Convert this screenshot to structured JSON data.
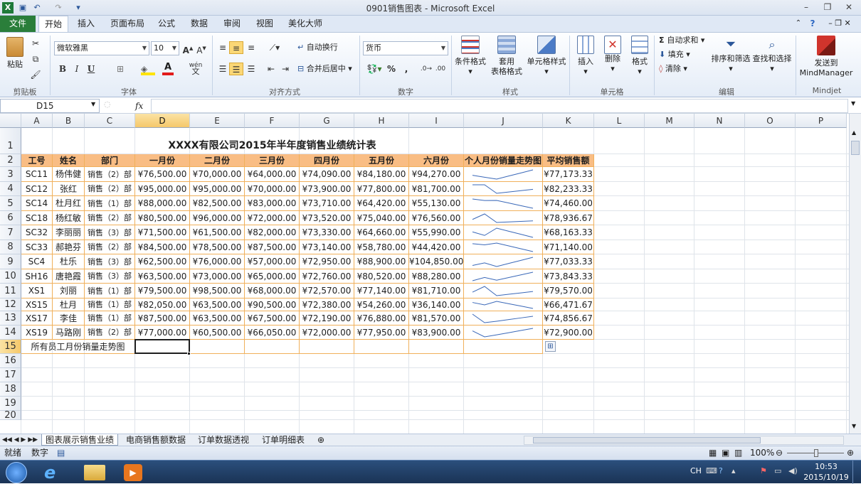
{
  "window": {
    "title": "0901销售图表 - Microsoft Excel"
  },
  "ribbon_tabs": [
    "文件",
    "开始",
    "插入",
    "页面布局",
    "公式",
    "数据",
    "审阅",
    "视图",
    "美化大师"
  ],
  "ribbon": {
    "paste_label": "粘贴",
    "clipboard_label": "剪贴板",
    "font_name": "微软雅黑",
    "font_size": "10",
    "bold": "B",
    "italic": "I",
    "underline": "U",
    "wen": "wén",
    "font_label": "字体",
    "wrap_text": "自动换行",
    "merge_center": "合并后居中",
    "align_label": "对齐方式",
    "number_format": "货币",
    "percent": "%",
    "comma": ",",
    "number_label": "数字",
    "cond_format": "条件格式",
    "table_format_1": "套用",
    "table_format_2": "表格格式",
    "cell_style": "单元格样式",
    "styles_label": "样式",
    "insert": "插入",
    "delete": "删除",
    "format": "格式",
    "cells_label": "单元格",
    "autosum": "自动求和",
    "fill": "填充",
    "clear": "清除",
    "sort_filter": "排序和筛选",
    "find_select": "查找和选择",
    "editing_label": "编辑",
    "send_to_1": "发送到",
    "send_to_2": "MindManager",
    "mindjet_label": "Mindjet"
  },
  "formula_bar": {
    "name_box": "D15",
    "fx": "fx",
    "formula": ""
  },
  "columns": [
    "A",
    "B",
    "C",
    "D",
    "E",
    "F",
    "G",
    "H",
    "I",
    "J",
    "K",
    "L",
    "M",
    "N",
    "O",
    "P"
  ],
  "rows": [
    "1",
    "2",
    "3",
    "4",
    "5",
    "6",
    "7",
    "8",
    "9",
    "10",
    "11",
    "12",
    "13",
    "14",
    "15",
    "16",
    "17",
    "18",
    "19",
    "20"
  ],
  "sheet_title": "XXXX有限公司2015年半年度销售业绩统计表",
  "headers": [
    "工号",
    "姓名",
    "部门",
    "一月份",
    "二月份",
    "三月份",
    "四月份",
    "五月份",
    "六月份",
    "个人月份销量走势图",
    "平均销售额"
  ],
  "table_rows": [
    {
      "id": "SC11",
      "name": "杨伟健",
      "dept": "销售（2）部",
      "m": [
        "¥76,500.00",
        "¥70,000.00",
        "¥64,000.00",
        "¥74,090.00",
        "¥84,180.00",
        "¥94,270.00"
      ],
      "avg": "¥77,173.33"
    },
    {
      "id": "SC12",
      "name": "张红",
      "dept": "销售（2）部",
      "m": [
        "¥95,000.00",
        "¥95,000.00",
        "¥70,000.00",
        "¥73,900.00",
        "¥77,800.00",
        "¥81,700.00"
      ],
      "avg": "¥82,233.33"
    },
    {
      "id": "SC14",
      "name": "杜月红",
      "dept": "销售（1）部",
      "m": [
        "¥88,000.00",
        "¥82,500.00",
        "¥83,000.00",
        "¥73,710.00",
        "¥64,420.00",
        "¥55,130.00"
      ],
      "avg": "¥74,460.00"
    },
    {
      "id": "SC18",
      "name": "杨红敏",
      "dept": "销售（2）部",
      "m": [
        "¥80,500.00",
        "¥96,000.00",
        "¥72,000.00",
        "¥73,520.00",
        "¥75,040.00",
        "¥76,560.00"
      ],
      "avg": "¥78,936.67"
    },
    {
      "id": "SC32",
      "name": "李丽丽",
      "dept": "销售（3）部",
      "m": [
        "¥71,500.00",
        "¥61,500.00",
        "¥82,000.00",
        "¥73,330.00",
        "¥64,660.00",
        "¥55,990.00"
      ],
      "avg": "¥68,163.33"
    },
    {
      "id": "SC33",
      "name": "郝艳芬",
      "dept": "销售（2）部",
      "m": [
        "¥84,500.00",
        "¥78,500.00",
        "¥87,500.00",
        "¥73,140.00",
        "¥58,780.00",
        "¥44,420.00"
      ],
      "avg": "¥71,140.00"
    },
    {
      "id": "SC4",
      "name": "杜乐",
      "dept": "销售（3）部",
      "m": [
        "¥62,500.00",
        "¥76,000.00",
        "¥57,000.00",
        "¥72,950.00",
        "¥88,900.00",
        "¥104,850.00"
      ],
      "avg": "¥77,033.33"
    },
    {
      "id": "SH16",
      "name": "唐艳霞",
      "dept": "销售（3）部",
      "m": [
        "¥63,500.00",
        "¥73,000.00",
        "¥65,000.00",
        "¥72,760.00",
        "¥80,520.00",
        "¥88,280.00"
      ],
      "avg": "¥73,843.33"
    },
    {
      "id": "XS1",
      "name": "刘丽",
      "dept": "销售（1）部",
      "m": [
        "¥79,500.00",
        "¥98,500.00",
        "¥68,000.00",
        "¥72,570.00",
        "¥77,140.00",
        "¥81,710.00"
      ],
      "avg": "¥79,570.00"
    },
    {
      "id": "XS15",
      "name": "杜月",
      "dept": "销售（1）部",
      "m": [
        "¥82,050.00",
        "¥63,500.00",
        "¥90,500.00",
        "¥72,380.00",
        "¥54,260.00",
        "¥36,140.00"
      ],
      "avg": "¥66,471.67"
    },
    {
      "id": "XS17",
      "name": "李佳",
      "dept": "销售（1）部",
      "m": [
        "¥87,500.00",
        "¥63,500.00",
        "¥67,500.00",
        "¥72,190.00",
        "¥76,880.00",
        "¥81,570.00"
      ],
      "avg": "¥74,856.67"
    },
    {
      "id": "XS19",
      "name": "马路刚",
      "dept": "销售（2）部",
      "m": [
        "¥77,000.00",
        "¥60,500.00",
        "¥66,050.00",
        "¥72,000.00",
        "¥77,950.00",
        "¥83,900.00"
      ],
      "avg": "¥72,900.00"
    }
  ],
  "row15_label": "所有员工月份销量走势图",
  "sparkline_color": "#3a68b8",
  "sheet_tabs": [
    "图表展示销售业绩",
    "电商销售额数据",
    "订单数据透视",
    "订单明细表"
  ],
  "status": {
    "ready": "就绪",
    "num": "数字",
    "zoom": "100%"
  },
  "taskbar": {
    "lang": "CH",
    "time": "10:53",
    "date": "2015/10/19"
  }
}
